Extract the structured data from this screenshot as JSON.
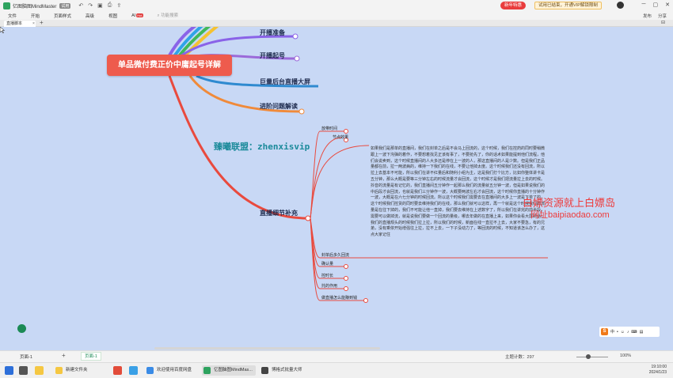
{
  "window": {
    "app_title": "亿图脑图MindMaster",
    "vip_label": "试用",
    "promo_label": "新年特惠",
    "trial_label": "试用已结束，开通VIP解锁限制"
  },
  "menu": {
    "items": [
      "文件",
      "开始",
      "页面样式",
      "高级",
      "视图"
    ],
    "ai_label": "AI",
    "ai_badge": "Hot",
    "search_placeholder": "功能搜索",
    "right_items": [
      "发布",
      "分享"
    ]
  },
  "tabs": {
    "doc_tab": "直播脚本",
    "close": "×",
    "add": "+"
  },
  "mindmap": {
    "central": "单品微付费正价中庸起号详解",
    "topics": [
      "开播准备",
      "开播起号",
      "巨量后台直播大屏",
      "进阶问题解读",
      "直播细节补充"
    ],
    "subtopics": [
      "放带时间",
      "节点效果",
      "封单后多久回流",
      "确认量",
      "控时长",
      "托的作用",
      "做直播怎么能赚到钱"
    ],
    "note": "如果我们是那单的直播间，我们在封单之后是不会马上回流的，这个时候，我们在控药的同时要稍微跟上一波下沟弹的着作，不要想着找见正该有事了，不要抢先了，你的话术如果能提到他们流程，他们会说卖到，这个时候直播间的人大多还是停在上一波的人，那这直播间的人是少数。但是我们正品量都在前，拉一两波病的，维持一下我们的在线，不要让他掉太度。这个时候我们还没有回流，所以拉上去基本不可能，所以我们在讲不红量后和随利小组为主，这是我们打个比方，比如你整体讲卡是五分钟，那么大概是要等三分钟左右的时候流量才会回流，这个时候才是我们把流量拉上去的时候。抖音的流量是有记忆的，我们直播间五分钟作一起那么我们的流量就五分钟一波，但是如果说我们的中后段才会回流，也就是我们三分钟作一波，大概要两波左右才会回流，这个时候你直播的十分钟作一波，大概是在六七分钟的时候回流。所以这个时候我们需要去在直播间的大多上一波是下单了的，这个时候我们控货的同时要去维持我们的在线，那么我们就可以这样，再一个就是这个时候我们的流量是在往下掉的，我们不可能让他一直掉，我们要去维持在上述数字了，所以我们在讲完的前半段，需要可以做掉流，就是说我们要做一个回流的量级，哪去年做的在直播上来，如果你会看大屏的话，我们的直播规头的时候我们拉上拉，所以我们的时候，新面在线一直拉不上去，大家不要急，有的兄弟，没有乘依开始增强往上拉，拉不上去，一下子没动力了，等回流的时候，不知道该怎么办了，这点大家记住"
  },
  "watermarks": {
    "cyan": "臻曦联盟：zhenxisvip",
    "red_line1": "白嫖资源就上白嫖岛",
    "red_line2": "网址baipiaodao.com"
  },
  "status": {
    "page_label": "页面-1",
    "add": "+",
    "page_tab": "页面-1",
    "topic_count_label": "主题计数：",
    "topic_count": "297",
    "zoom": "100%"
  },
  "taskbar": {
    "items": [
      "新建文件夹",
      "欢迎使用百度网盘",
      "亿图脑图MindMas...",
      "博格式批量大师"
    ],
    "time": "19:10:00",
    "date": "2024/1/23"
  },
  "colors": {
    "central": "#ee5b4d",
    "canvas": "#c8d8f5",
    "branch_purple": "#8a63e8",
    "branch_orange": "#f08a3a",
    "branch_red": "#e94a3e"
  }
}
